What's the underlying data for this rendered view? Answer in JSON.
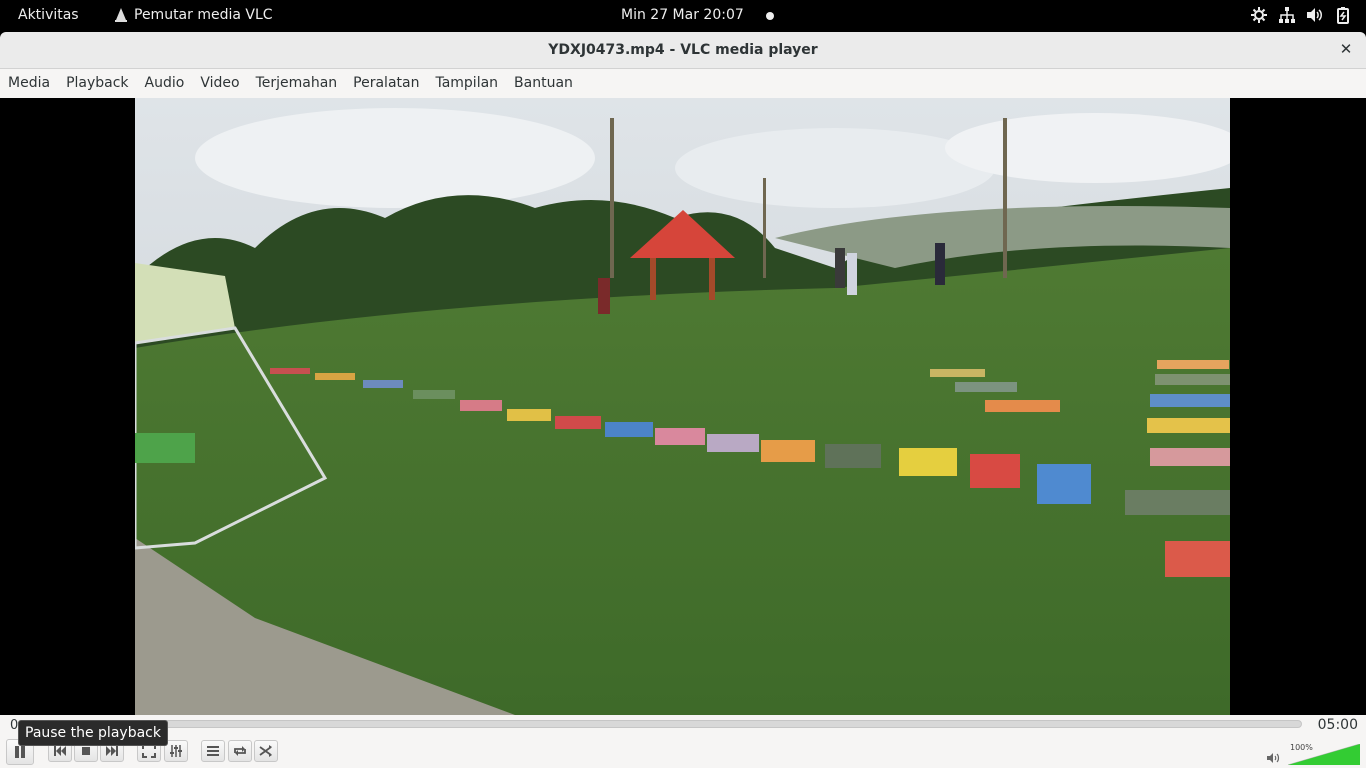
{
  "topbar": {
    "activities": "Aktivitas",
    "app_name": "Pemutar media VLC",
    "clock": "Min 27 Mar  20:07"
  },
  "window": {
    "title": "YDXJ0473.mp4 - VLC media player"
  },
  "menu": [
    "Media",
    "Playback",
    "Audio",
    "Video",
    "Terjemahan",
    "Peralatan",
    "Tampilan",
    "Bantuan"
  ],
  "player": {
    "time_elapsed": "0",
    "time_total": "05:00",
    "tooltip": "Pause the playback",
    "volume": "100%",
    "volume_level": 1.0,
    "progress": 0.0
  },
  "icons": {
    "play": "pause-icon",
    "prev": "skip-back-icon",
    "stop": "stop-icon",
    "next": "skip-forward-icon",
    "fullscreen": "fullscreen-icon",
    "ext": "equalizer-icon",
    "playlist": "playlist-icon",
    "loop": "loop-icon",
    "shuffle": "shuffle-icon",
    "volume": "speaker-icon"
  },
  "colors": {
    "accent_volume": "#33cc33",
    "topbar_bg": "#000000"
  }
}
